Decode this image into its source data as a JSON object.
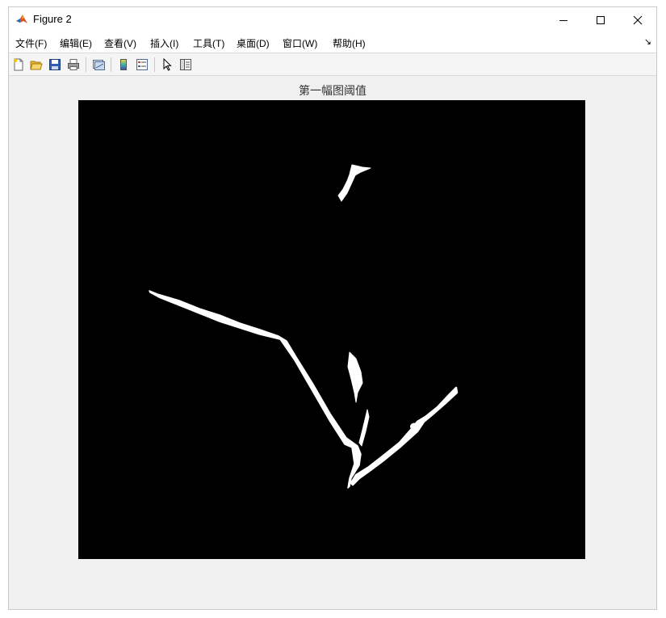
{
  "window": {
    "title": "Figure 2",
    "icon": "matlab-icon",
    "controls": [
      "minimize-icon",
      "maximize-icon",
      "close-icon"
    ]
  },
  "menu": {
    "items": [
      {
        "label": "文件(F)"
      },
      {
        "label": "编辑(E)"
      },
      {
        "label": "查看(V)"
      },
      {
        "label": "插入(I)"
      },
      {
        "label": "工具(T)"
      },
      {
        "label": "桌面(D)"
      },
      {
        "label": "窗口(W)"
      },
      {
        "label": "帮助(H)"
      }
    ],
    "overflow_icon": "dock-arrow-icon"
  },
  "toolbar": {
    "buttons": [
      "new-figure-icon",
      "open-file-icon",
      "save-icon",
      "print-icon",
      "link-plot-icon",
      "colorbar-icon",
      "legend-icon",
      "pointer-icon",
      "property-inspector-icon"
    ]
  },
  "figure": {
    "axes_title": "第一幅图阈值",
    "image_description": "binary threshold image",
    "colors": {
      "background": "#000000",
      "foreground": "#ffffff"
    }
  }
}
